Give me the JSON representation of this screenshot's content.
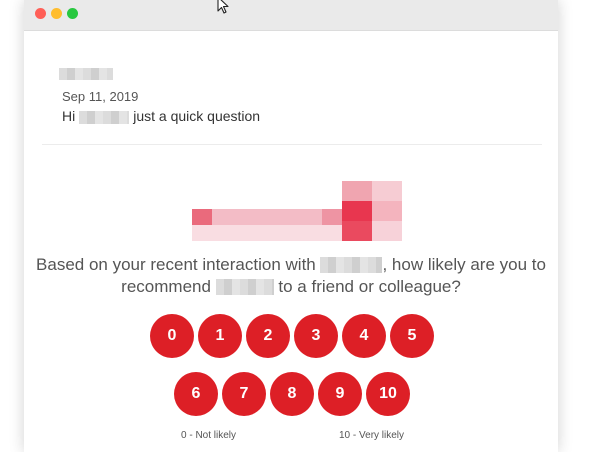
{
  "email": {
    "date": "Sep 11, 2019",
    "greeting_prefix": "Hi",
    "greeting_suffix": "just a quick question"
  },
  "survey": {
    "question_part1": "Based on your recent interaction with",
    "question_part2": ", how likely are you to recommend",
    "question_part3": "to a friend or colleague?",
    "scores_row1": [
      "0",
      "1",
      "2",
      "3",
      "4",
      "5"
    ],
    "scores_row2": [
      "6",
      "7",
      "8",
      "9",
      "10"
    ],
    "low_label": "0 - Not likely",
    "high_label": "10 - Very likely"
  },
  "colors": {
    "score_button": "#dd1f26",
    "titlebar_close": "#ff5f57",
    "titlebar_minimize": "#ffbd2e",
    "titlebar_maximize": "#28c840"
  },
  "icons": [
    "close-dot-icon",
    "minimize-dot-icon",
    "maximize-dot-icon",
    "cursor-icon"
  ]
}
